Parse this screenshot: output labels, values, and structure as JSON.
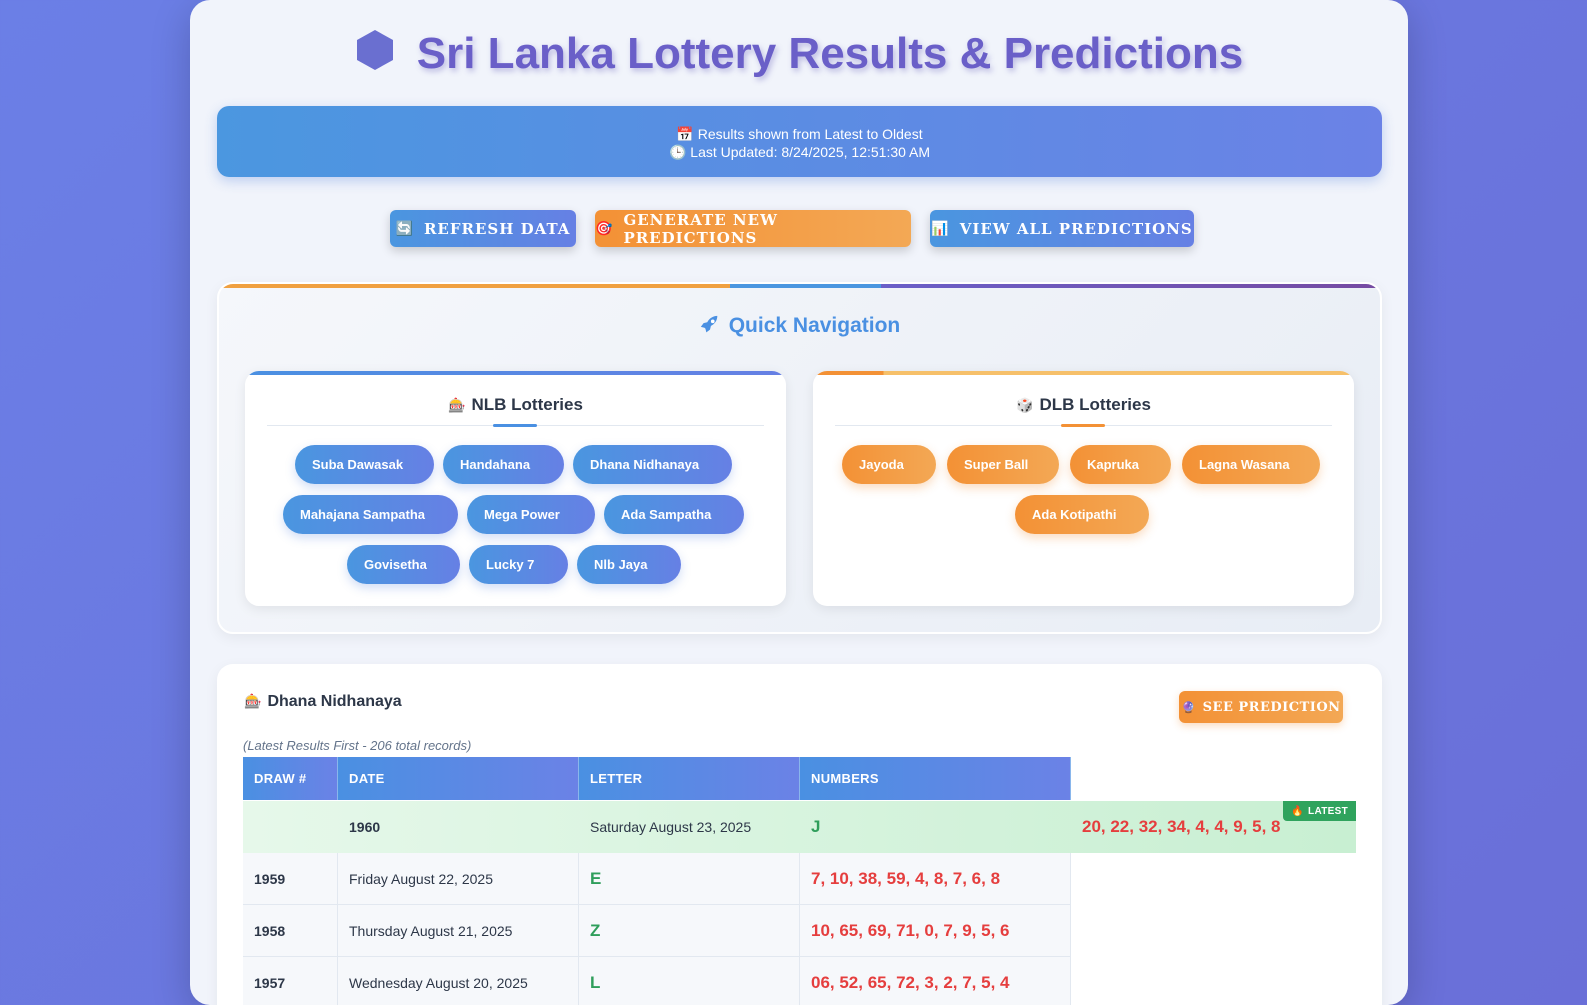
{
  "header": {
    "title": "Sri Lanka Lottery Results & Predictions",
    "logo_icon": "hexagon-icon"
  },
  "info": {
    "order_text": "Results shown from Latest to Oldest",
    "order_icon": "calendar-icon",
    "updated_text": "Last Updated: 8/24/2025, 12:51:30 AM",
    "updated_icon": "clock-icon"
  },
  "actions": {
    "refresh": {
      "label": "REFRESH DATA",
      "icon": "🔄"
    },
    "generate": {
      "label": "GENERATE NEW PREDICTIONS",
      "icon": "🎯"
    },
    "view_all": {
      "label": "VIEW ALL PREDICTIONS",
      "icon": "📊"
    }
  },
  "quick_nav": {
    "title": "Quick Navigation",
    "icon": "rocket-icon",
    "nlb": {
      "title": "NLB Lotteries",
      "icon": "🎰",
      "items": [
        "Suba Dawasak",
        "Handahana",
        "Dhana Nidhanaya",
        "Mahajana Sampatha",
        "Mega Power",
        "Ada Sampatha",
        "Govisetha",
        "Lucky 7",
        "Nlb Jaya"
      ]
    },
    "dlb": {
      "title": "DLB Lotteries",
      "icon": "🎲",
      "items": [
        "Jayoda",
        "Super Ball",
        "Kapruka",
        "Lagna Wasana",
        "Ada Kotipathi"
      ]
    }
  },
  "results": {
    "title": "Dhana Nidhanaya",
    "icon": "🎰",
    "see_prediction": {
      "label": "SEE PREDICTION",
      "icon": "🔮"
    },
    "subtitle": "(Latest Results First - 206 total records)",
    "columns": [
      "DRAW #",
      "DATE",
      "LETTER",
      "NUMBERS"
    ],
    "latest_badge": "LATEST",
    "latest_badge_icon": "🔥",
    "rows": [
      {
        "draw": "1960",
        "date": "Saturday August 23, 2025",
        "letter": "J",
        "numbers": "20, 22, 32, 34, 4, 4, 9, 5, 8"
      },
      {
        "draw": "1959",
        "date": "Friday August 22, 2025",
        "letter": "E",
        "numbers": "7, 10, 38, 59, 4, 8, 7, 6, 8"
      },
      {
        "draw": "1958",
        "date": "Thursday August 21, 2025",
        "letter": "Z",
        "numbers": "10, 65, 69, 71, 0, 7, 9, 5, 6"
      },
      {
        "draw": "1957",
        "date": "Wednesday August 20, 2025",
        "letter": "L",
        "numbers": "06, 52, 65, 72, 3, 2, 7, 5, 4"
      }
    ]
  },
  "colors": {
    "accent_blue": "#4a90e2",
    "accent_orange": "#f39135",
    "title_purple": "#6a5fc8",
    "number_red": "#e53e3e",
    "letter_green": "#2f9e5b"
  }
}
